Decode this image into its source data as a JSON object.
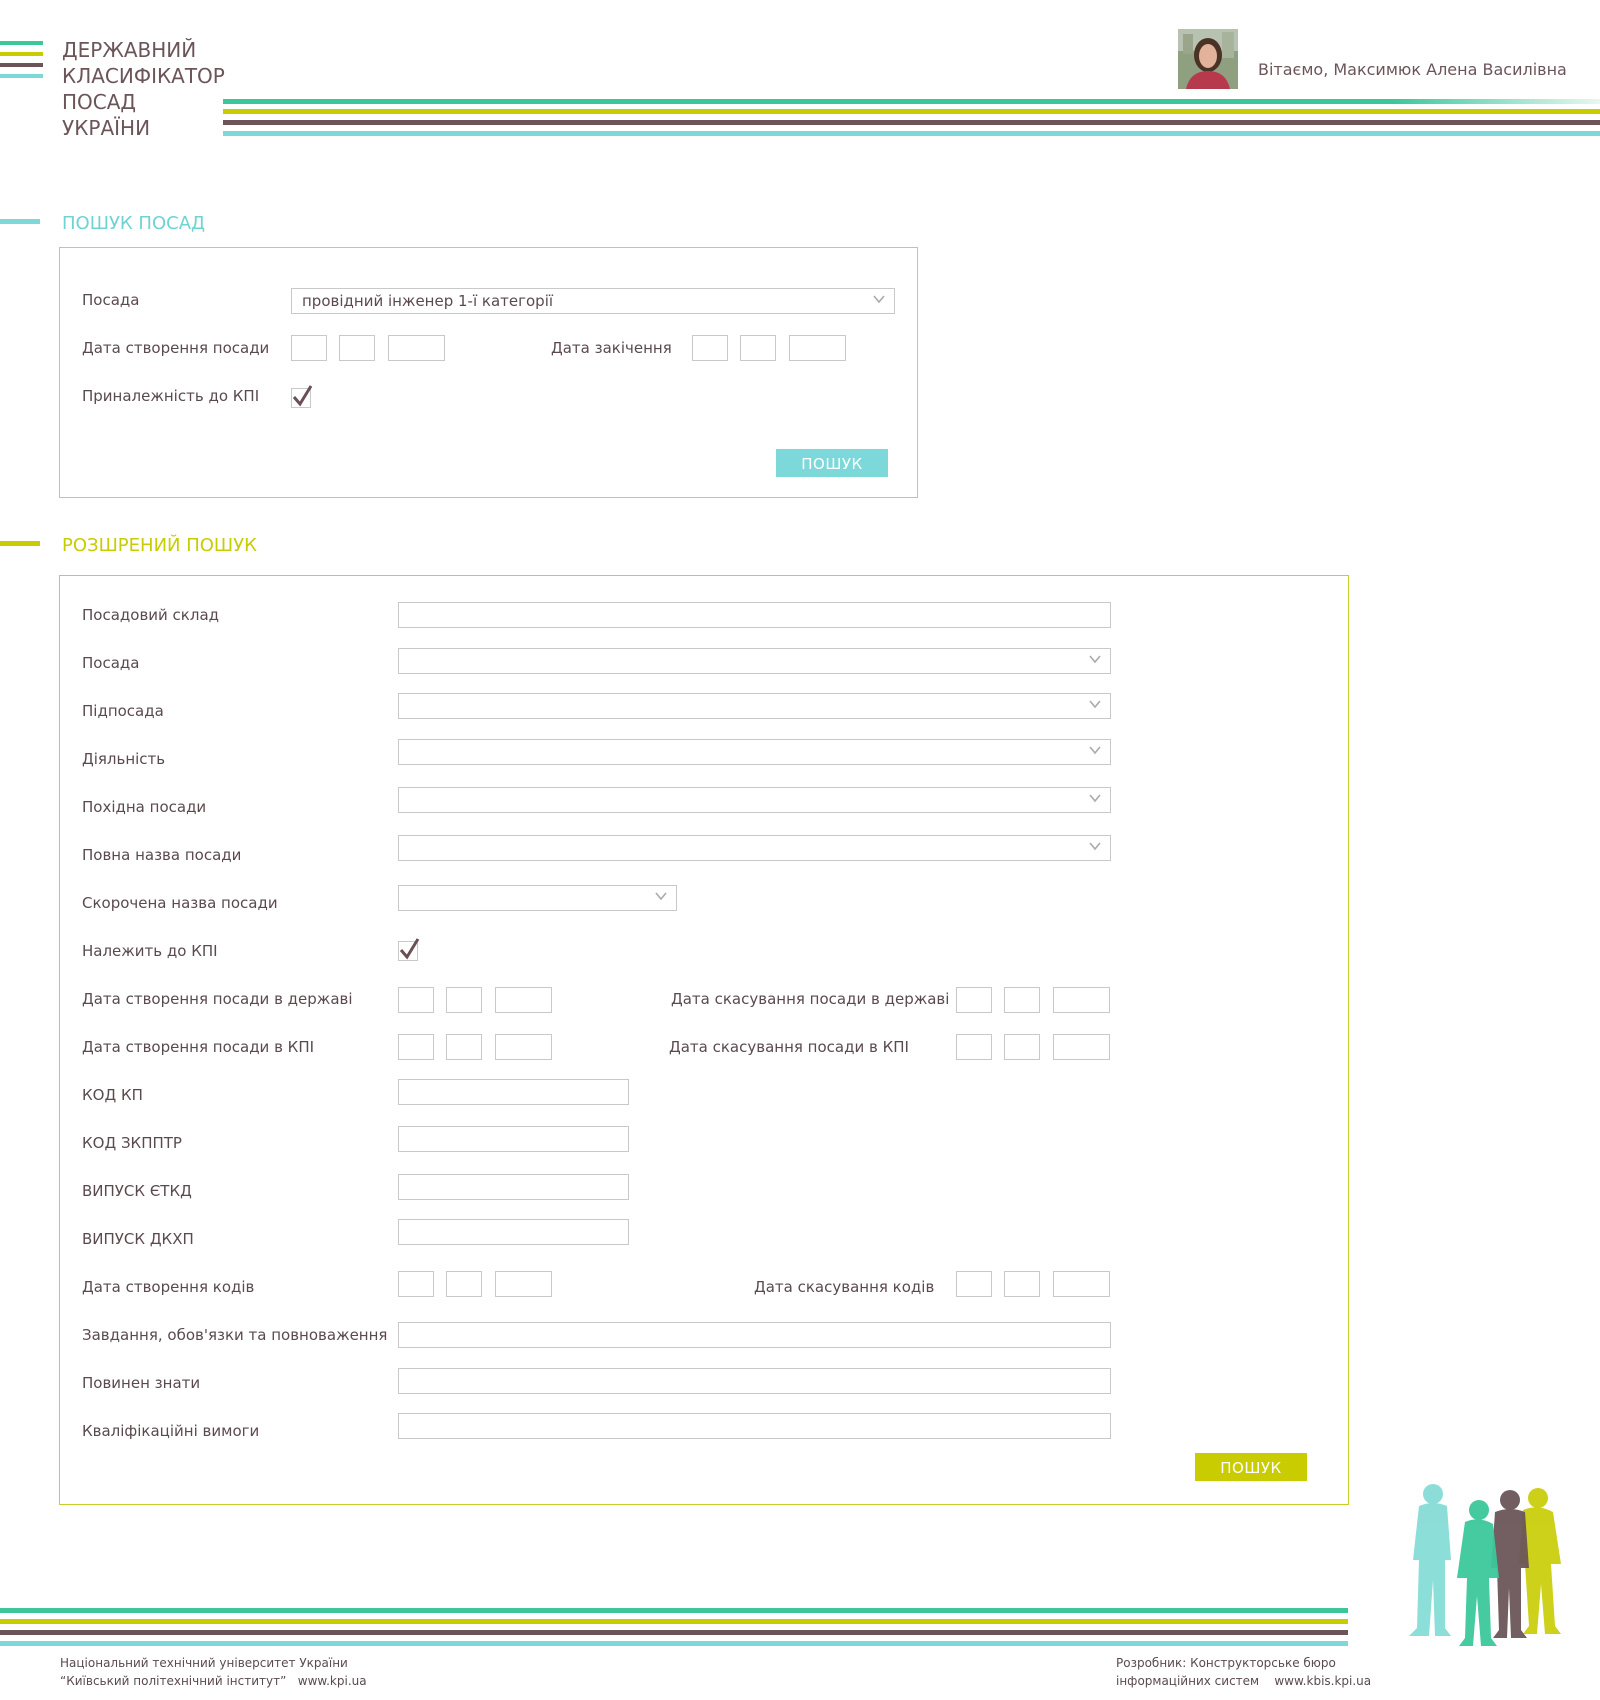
{
  "logo": {
    "lines": [
      "ДЕРЖАВНИЙ",
      "КЛАСИФІКАТОР",
      "ПОСАД",
      "УКРАЇНИ"
    ]
  },
  "user": {
    "greeting": "Вітаємо, Максимюк Алена Василівна"
  },
  "colors": {
    "teal": "#7dd9d9",
    "lime": "#c8cc00",
    "green": "#3cc79a",
    "brown": "#6b5559",
    "text": "#5b4a4d"
  },
  "search": {
    "title": "ПОШУК ПОСАД",
    "position_label": "Посада",
    "position_value": "провідний інженер 1-ї категорії",
    "created_label": "Дата створення посади",
    "ended_label": "Дата закічення",
    "kpi_label": "Приналежність до КПІ",
    "kpi_checked": true,
    "button": "ПОШУК"
  },
  "advanced": {
    "title": "РОЗШРЕНИЙ ПОШУК",
    "staff_label": "Посадовий склад",
    "position_label": "Посада",
    "subposition_label": "Підпосада",
    "activity_label": "Діяльність",
    "derived_label": "Похідна посади",
    "full_name_label": "Повна назва посади",
    "short_name_label": "Скорочена назва посади",
    "kpi_label": "Належить до КПІ",
    "kpi_checked": true,
    "state_created_label": "Дата створення посади в державі",
    "state_cancel_label": "Дата скасування посади в державі",
    "kpi_created_label": "Дата створення посади в КПІ",
    "kpi_cancel_label": "Дата скасування посади в КПІ",
    "kp_code_label": "КОД КП",
    "zkpptr_code_label": "КОД ЗКППТР",
    "etkd_label": "ВИПУСК ЄТКД",
    "dkhp_label": "ВИПУСК ДКХП",
    "codes_created_label": "Дата створення кодів",
    "codes_cancel_label": "Дата скасування кодів",
    "duties_label": "Завдання, обов'язки та повноваження",
    "must_know_label": "Повинен знати",
    "qualification_label": "Кваліфікаційні вимоги",
    "button": "ПОШУК"
  },
  "footer": {
    "left_line1": "Національний технічний університет України",
    "left_line2": "“Київський політехнічний інститут”   www.kpi.ua",
    "right_line1": "Розробник: Конструкторське бюро",
    "right_line2": "інформаційних систем    www.kbis.kpi.ua"
  }
}
